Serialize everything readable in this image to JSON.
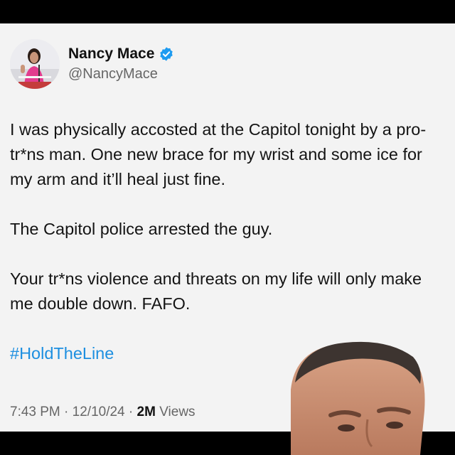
{
  "tweet": {
    "author": {
      "display_name": "Nancy Mace",
      "handle": "@NancyMace",
      "verified_icon": "verified-badge-icon",
      "verified_color": "#1d9bf0"
    },
    "paragraphs": [
      "I was physically accosted at the Capitol tonight by a pro-tr*ns man. One new brace for my wrist and some ice for my arm and it’ll heal just fine.",
      "The Capitol police arrested the guy.",
      "Your tr*ns violence and threats on my life will only make me double down. FAFO."
    ],
    "hashtag": "#HoldTheLine",
    "hashtag_color": "#1d8fe0",
    "meta": {
      "time": "7:43 PM",
      "separator": " · ",
      "date": "12/10/24",
      "views_count": "2M",
      "views_label": " Views"
    }
  },
  "colors": {
    "background": "#000000",
    "card": "#f3f3f3",
    "text": "#141414",
    "muted": "#666666"
  }
}
